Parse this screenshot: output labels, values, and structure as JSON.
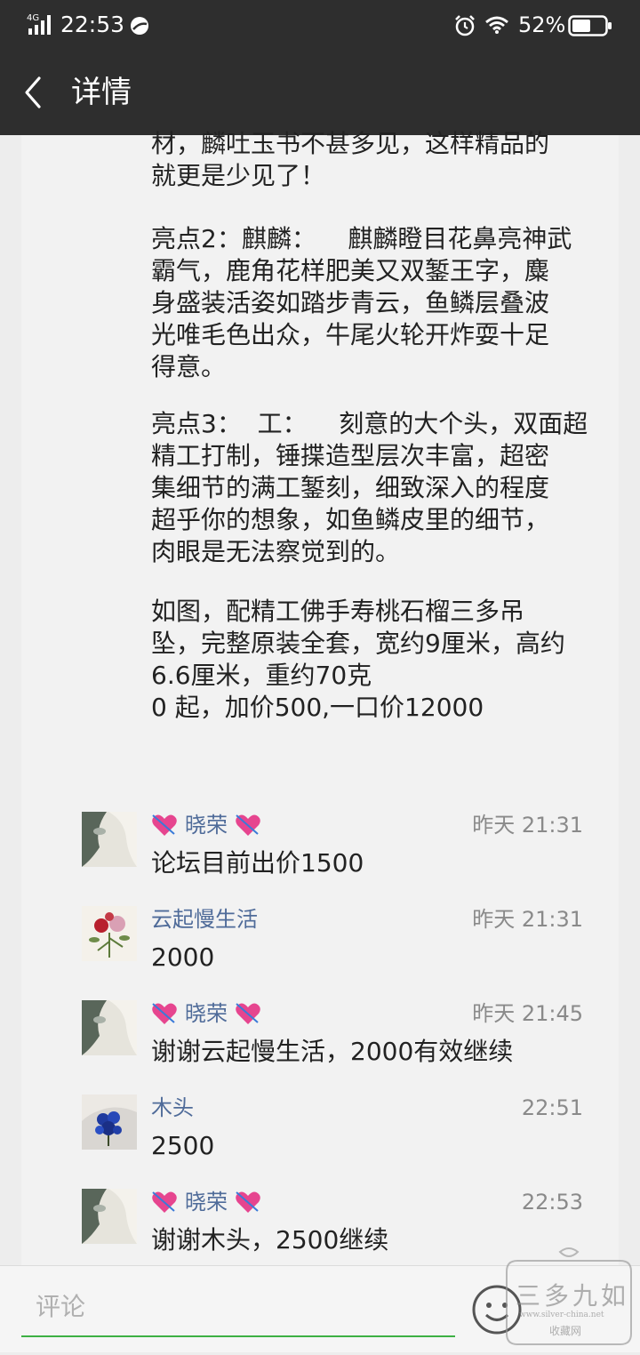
{
  "status_bar": {
    "network": "4G",
    "time": "22:53",
    "battery": "52%"
  },
  "nav": {
    "title": "详情"
  },
  "post": {
    "paragraphs": [
      "材，麟吐玉书不甚多见，这样精品的\n就更是少见了！",
      "亮点2：麒麟：    麒麟瞪目花鼻亮神武\n霸气，鹿角花样肥美又双錾王字，麋\n身盛装活姿如踏步青云，鱼鳞层叠波\n光唯毛色出众，牛尾火轮开炸耍十足\n得意。",
      "亮点3：  工：    刻意的大个头，双面超\n精工打制，锤揲造型层次丰富，超密\n集细节的满工錾刻，细致深入的程度\n超乎你的想象，如鱼鳞皮里的细节，\n肉眼是无法察觉到的。",
      "如图，配精工佛手寿桃石榴三多吊\n坠，完整原装全套，宽约9厘米，高约\n6.6厘米，重约70克\n0 起，加价500,一口价12000"
    ]
  },
  "comments": [
    {
      "name": "晓荣",
      "hearts": true,
      "avatar": "figure-avatar",
      "time": "昨天 21:31",
      "text": "论坛目前出价1500"
    },
    {
      "name": "云起慢生活",
      "hearts": false,
      "avatar": "flower-avatar",
      "time": "昨天 21:31",
      "text": "2000"
    },
    {
      "name": "晓荣",
      "hearts": true,
      "avatar": "figure-avatar",
      "time": "昨天 21:45",
      "text": "谢谢云起慢生活，2000有效继续"
    },
    {
      "name": "木头",
      "hearts": false,
      "avatar": "blue-flower-avatar",
      "time": "22:51",
      "text": "2500"
    },
    {
      "name": "晓荣",
      "hearts": true,
      "avatar": "figure-avatar",
      "time": "22:53",
      "text": "谢谢木头，2500继续"
    }
  ],
  "bottom_bar": {
    "comment_placeholder": "评论"
  },
  "watermark": {
    "main": "三多九如",
    "url": "www.silver-china.net",
    "sub": "收藏网"
  },
  "colors": {
    "header_bg": "#2e2e2e",
    "link_blue": "#4f6b99",
    "input_underline": "#3db044"
  }
}
